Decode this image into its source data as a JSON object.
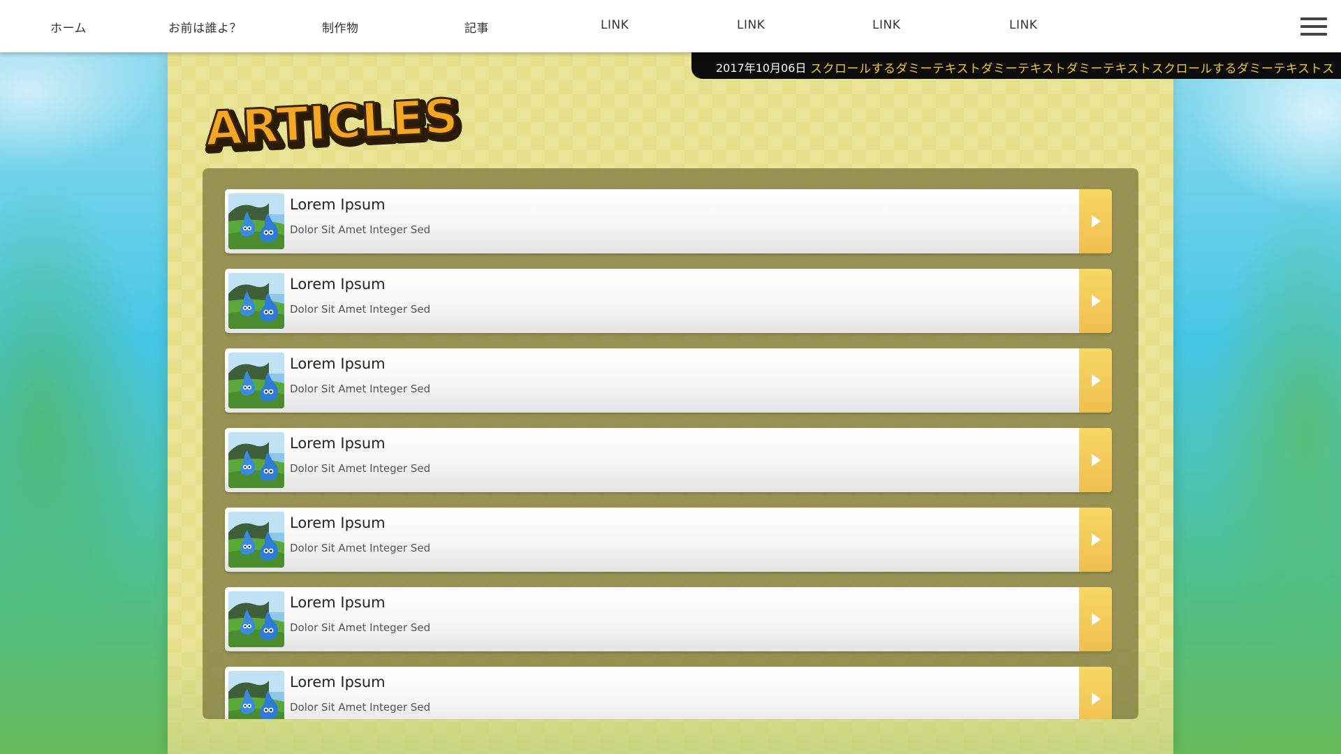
{
  "nav": {
    "items": [
      {
        "label": "ホーム",
        "name": "nav-home"
      },
      {
        "label": "お前は誰よ？",
        "name": "nav-about"
      },
      {
        "label": "制作物",
        "name": "nav-works"
      },
      {
        "label": "記事",
        "name": "nav-articles"
      },
      {
        "label": "LINK",
        "name": "nav-link-1"
      },
      {
        "label": "LINK",
        "name": "nav-link-2"
      },
      {
        "label": "LINK",
        "name": "nav-link-3"
      },
      {
        "label": "LINK",
        "name": "nav-link-4"
      }
    ],
    "menu_icon": "hamburger-menu-icon"
  },
  "ticker": {
    "date": "2017年10月06日",
    "text": "スクロールするダミーテキストダミーテキストダミーテキストスクロールするダミーテキストス"
  },
  "page": {
    "title": "ARTICLES"
  },
  "articles": [
    {
      "title": "Lorem Ipsum",
      "subtitle": "Dolor Sit Amet Integer Sed"
    },
    {
      "title": "Lorem Ipsum",
      "subtitle": "Dolor Sit Amet Integer Sed"
    },
    {
      "title": "Lorem Ipsum",
      "subtitle": "Dolor Sit Amet Integer Sed"
    },
    {
      "title": "Lorem Ipsum",
      "subtitle": "Dolor Sit Amet Integer Sed"
    },
    {
      "title": "Lorem Ipsum",
      "subtitle": "Dolor Sit Amet Integer Sed"
    },
    {
      "title": "Lorem Ipsum",
      "subtitle": "Dolor Sit Amet Integer Sed"
    },
    {
      "title": "Lorem Ipsum",
      "subtitle": "Dolor Sit Amet Integer Sed"
    }
  ],
  "colors": {
    "ticker_text": "#f2c830",
    "arrow_button": "#f0c552",
    "title_fill": "#f5a623",
    "panel": "#e6e08a"
  }
}
